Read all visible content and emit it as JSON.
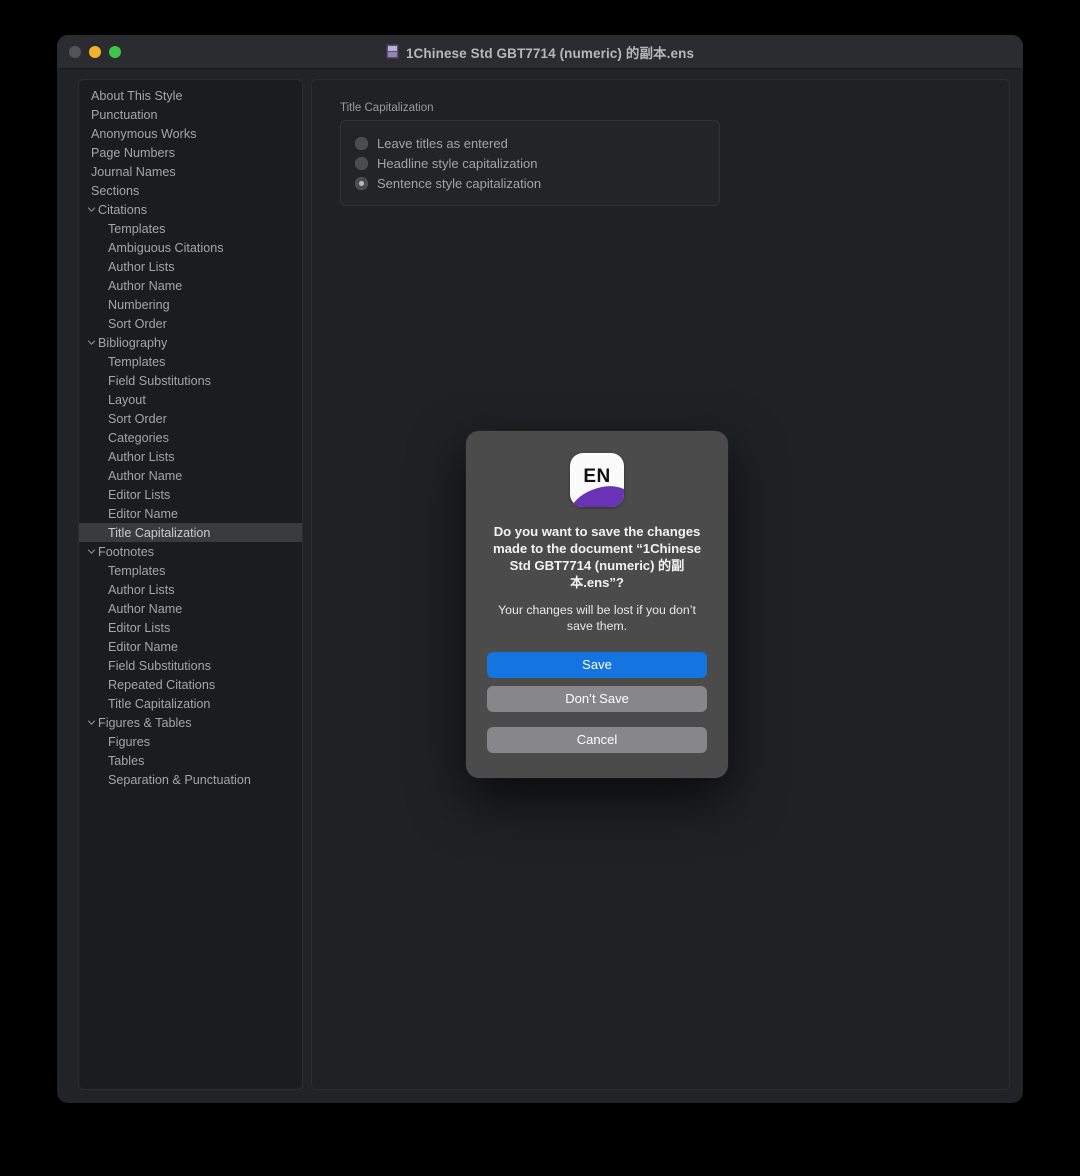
{
  "window": {
    "title": "1Chinese Std GBT7714 (numeric) 的副本.ens",
    "doc_icon": "document-icon",
    "traffic_lights": {
      "close": "close-button",
      "minimize": "minimize-button",
      "zoom": "zoom-button"
    }
  },
  "sidebar": {
    "items": [
      {
        "label": "About This Style",
        "level": 0,
        "group": false,
        "selected": false
      },
      {
        "label": "Punctuation",
        "level": 0,
        "group": false,
        "selected": false
      },
      {
        "label": "Anonymous Works",
        "level": 0,
        "group": false,
        "selected": false
      },
      {
        "label": "Page Numbers",
        "level": 0,
        "group": false,
        "selected": false
      },
      {
        "label": "Journal Names",
        "level": 0,
        "group": false,
        "selected": false
      },
      {
        "label": "Sections",
        "level": 0,
        "group": false,
        "selected": false
      },
      {
        "label": "Citations",
        "level": 0,
        "group": true,
        "selected": false
      },
      {
        "label": "Templates",
        "level": 1,
        "group": false,
        "selected": false
      },
      {
        "label": "Ambiguous Citations",
        "level": 1,
        "group": false,
        "selected": false
      },
      {
        "label": "Author Lists",
        "level": 1,
        "group": false,
        "selected": false
      },
      {
        "label": "Author Name",
        "level": 1,
        "group": false,
        "selected": false
      },
      {
        "label": "Numbering",
        "level": 1,
        "group": false,
        "selected": false
      },
      {
        "label": "Sort Order",
        "level": 1,
        "group": false,
        "selected": false
      },
      {
        "label": "Bibliography",
        "level": 0,
        "group": true,
        "selected": false
      },
      {
        "label": "Templates",
        "level": 1,
        "group": false,
        "selected": false
      },
      {
        "label": "Field Substitutions",
        "level": 1,
        "group": false,
        "selected": false
      },
      {
        "label": "Layout",
        "level": 1,
        "group": false,
        "selected": false
      },
      {
        "label": "Sort Order",
        "level": 1,
        "group": false,
        "selected": false
      },
      {
        "label": "Categories",
        "level": 1,
        "group": false,
        "selected": false
      },
      {
        "label": "Author Lists",
        "level": 1,
        "group": false,
        "selected": false
      },
      {
        "label": "Author Name",
        "level": 1,
        "group": false,
        "selected": false
      },
      {
        "label": "Editor Lists",
        "level": 1,
        "group": false,
        "selected": false
      },
      {
        "label": "Editor Name",
        "level": 1,
        "group": false,
        "selected": false
      },
      {
        "label": "Title Capitalization",
        "level": 1,
        "group": false,
        "selected": true
      },
      {
        "label": "Footnotes",
        "level": 0,
        "group": true,
        "selected": false
      },
      {
        "label": "Templates",
        "level": 1,
        "group": false,
        "selected": false
      },
      {
        "label": "Author Lists",
        "level": 1,
        "group": false,
        "selected": false
      },
      {
        "label": "Author Name",
        "level": 1,
        "group": false,
        "selected": false
      },
      {
        "label": "Editor Lists",
        "level": 1,
        "group": false,
        "selected": false
      },
      {
        "label": "Editor Name",
        "level": 1,
        "group": false,
        "selected": false
      },
      {
        "label": "Field Substitutions",
        "level": 1,
        "group": false,
        "selected": false
      },
      {
        "label": "Repeated Citations",
        "level": 1,
        "group": false,
        "selected": false
      },
      {
        "label": "Title Capitalization",
        "level": 1,
        "group": false,
        "selected": false
      },
      {
        "label": "Figures & Tables",
        "level": 0,
        "group": true,
        "selected": false
      },
      {
        "label": "Figures",
        "level": 1,
        "group": false,
        "selected": false
      },
      {
        "label": "Tables",
        "level": 1,
        "group": false,
        "selected": false
      },
      {
        "label": "Separation & Punctuation",
        "level": 1,
        "group": false,
        "selected": false
      }
    ]
  },
  "content": {
    "group_label": "Title Capitalization",
    "options": [
      {
        "label": "Leave titles as entered",
        "selected": false
      },
      {
        "label": "Headline style capitalization",
        "selected": false
      },
      {
        "label": "Sentence style capitalization",
        "selected": true
      }
    ]
  },
  "dialog": {
    "app_icon_text": "EN",
    "title": "Do you want to save the changes made to the document “1Chinese Std GBT7714 (numeric) 的副本.ens”?",
    "subtitle": "Your changes will be lost if you don’t save them.",
    "buttons": {
      "save": "Save",
      "dont_save": "Don’t Save",
      "cancel": "Cancel"
    },
    "accent_color": "#1474e0",
    "neutral_color": "#878789"
  }
}
